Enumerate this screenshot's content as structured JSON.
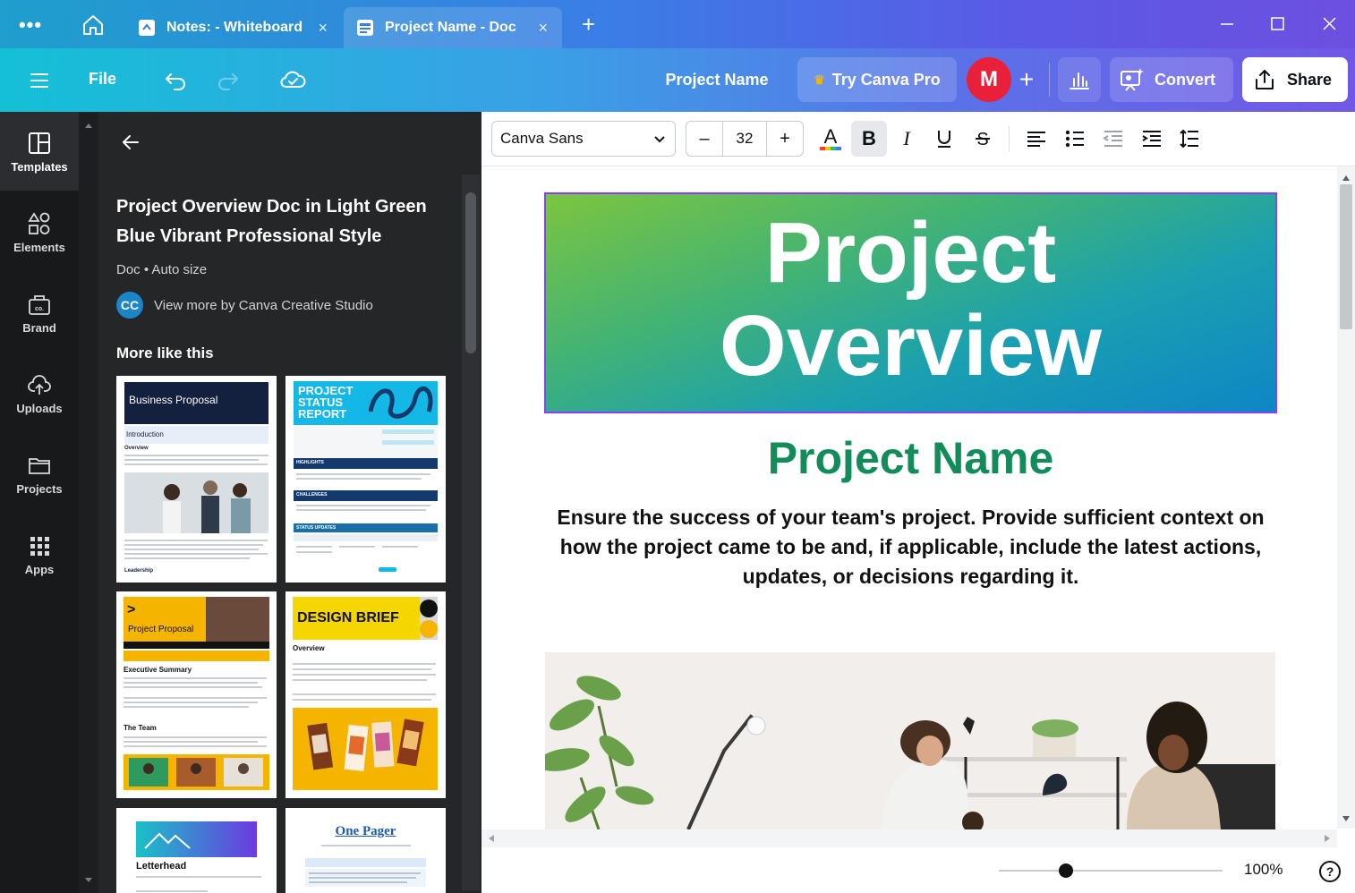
{
  "browser": {
    "tabs": [
      {
        "label": "Notes: - Whiteboard",
        "active": false
      },
      {
        "label": "Project Name - Doc",
        "active": true
      }
    ],
    "close_glyph": "×",
    "new_tab_glyph": "+",
    "menu_glyph": "•••"
  },
  "header": {
    "file_label": "File",
    "project_title": "Project Name",
    "try_pro_label": "Try Canva Pro",
    "avatar_initial": "M",
    "add_glyph": "+",
    "convert_label": "Convert",
    "share_label": "Share"
  },
  "rail": {
    "items": [
      {
        "label": "Templates",
        "icon": "templates-icon"
      },
      {
        "label": "Elements",
        "icon": "elements-icon"
      },
      {
        "label": "Brand",
        "icon": "brand-icon"
      },
      {
        "label": "Uploads",
        "icon": "uploads-icon"
      },
      {
        "label": "Projects",
        "icon": "projects-icon"
      },
      {
        "label": "Apps",
        "icon": "apps-icon"
      }
    ]
  },
  "panel": {
    "title": "Project Overview Doc in Light Green Blue Vibrant Professional Style",
    "meta": "Doc • Auto size",
    "author_initials": "CC",
    "author_link": "View more by Canva Creative Studio",
    "more_heading": "More like this",
    "thumbnails": [
      {
        "title": "Business Proposal",
        "subtitle": "Introduction",
        "section": "Overview",
        "footer": "Leadership"
      },
      {
        "title": "PROJECT STATUS REPORT",
        "sections": [
          "HIGHLIGHTS",
          "CHALLENGES",
          "STATUS UPDATES"
        ]
      },
      {
        "title": "Project Proposal",
        "sections": [
          "Executive Summary",
          "The Team"
        ]
      },
      {
        "title": "DESIGN BRIEF",
        "sections": [
          "Overview"
        ]
      },
      {
        "title": "Letterhead"
      },
      {
        "title": "One Pager"
      }
    ]
  },
  "toolbar": {
    "font_name": "Canva Sans",
    "font_size": "32",
    "minus": "–",
    "plus": "+"
  },
  "document": {
    "hero_line1": "Project",
    "hero_line2": "Overview",
    "project_name": "Project Name",
    "description": "Ensure the success of your team's project. Provide sufficient context on how the project came to be and, if applicable, include the latest actions, updates, or decisions regarding it."
  },
  "footer": {
    "zoom": "100%",
    "zoom_level": 0.3,
    "help_glyph": "?"
  },
  "colors": {
    "accent_purple": "#8b3dff",
    "project_name_green": "#128c5a",
    "avatar_red": "#e8203a"
  }
}
